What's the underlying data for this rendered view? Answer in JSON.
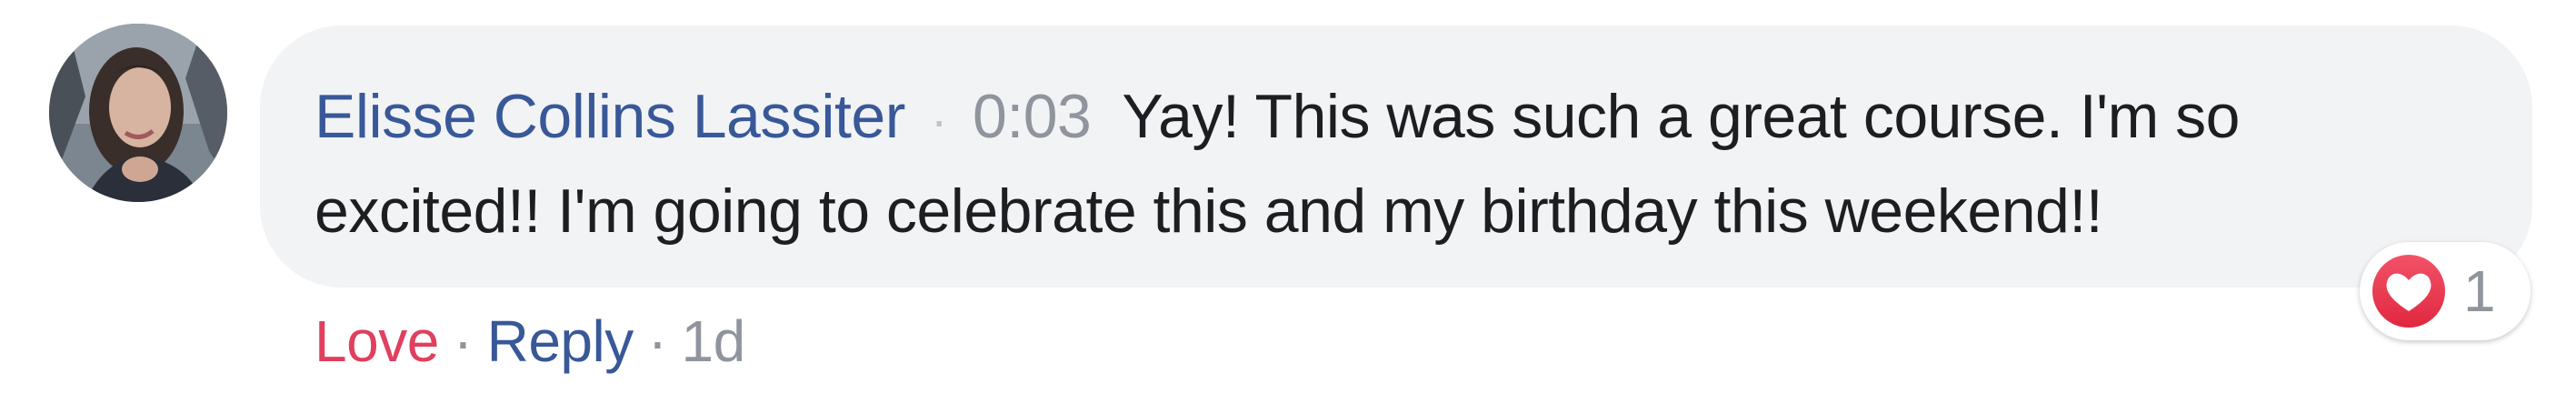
{
  "comment": {
    "author": "Elisse Collins Lassiter",
    "separator": "·",
    "timestamp": "0:03",
    "text_line1": "Yay! This was such a great course. I'm so",
    "text_line2": "excited!! I'm going to celebrate this and my birthday this weekend!!",
    "avatar_icon": "user-avatar-photo"
  },
  "reaction": {
    "icon": "love-heart-icon",
    "count": "1",
    "color": "#e0405e"
  },
  "actions": {
    "love_label": "Love",
    "reply_label": "Reply",
    "separator": "·",
    "age": "1d"
  },
  "colors": {
    "author_link": "#385898",
    "bubble_bg": "#f2f3f5",
    "muted_text": "#90949c",
    "body_text": "#1c1e21"
  }
}
